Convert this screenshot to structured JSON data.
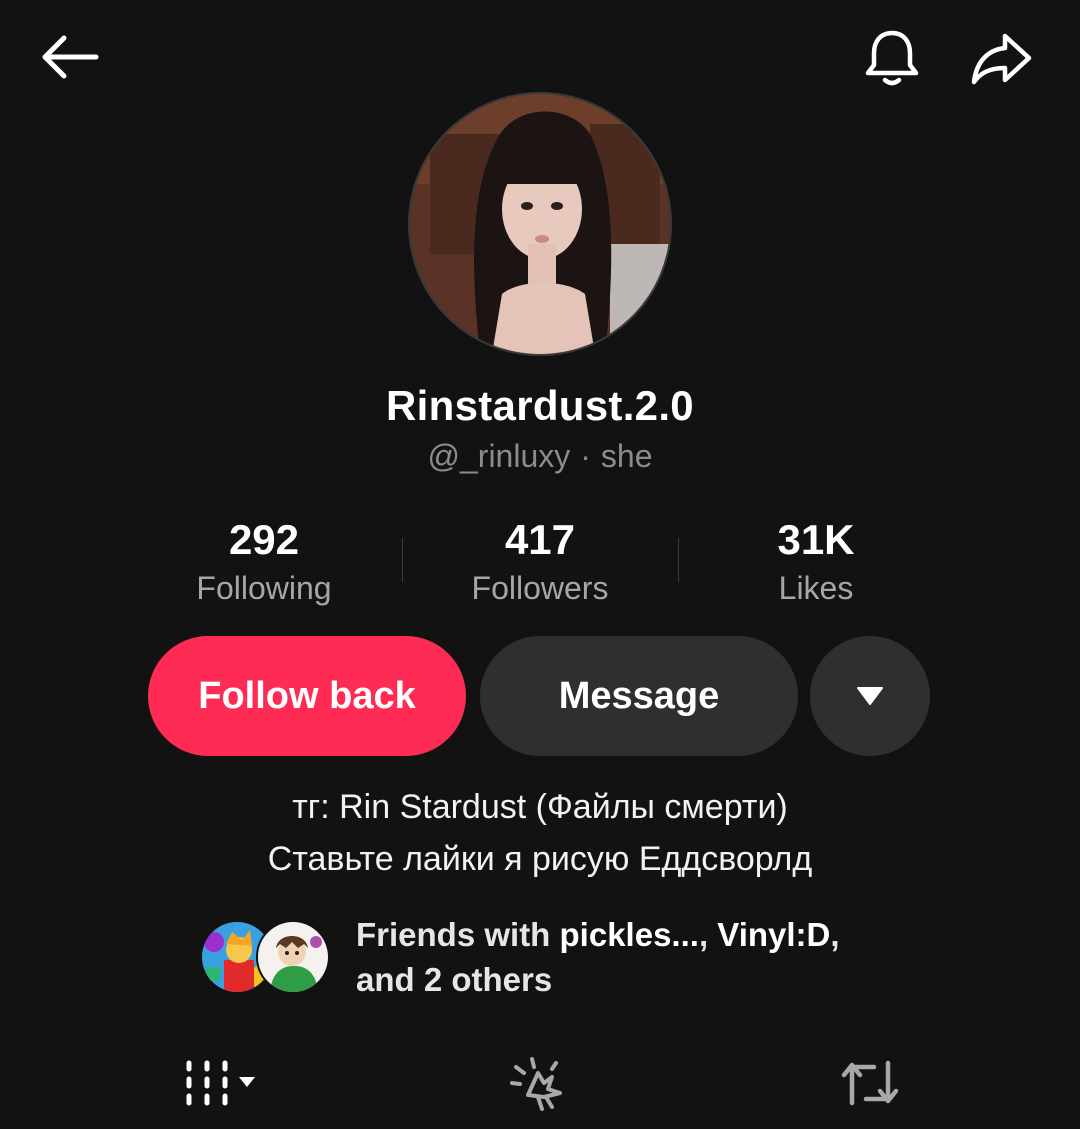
{
  "topbar": {
    "back_icon": "arrow-left-icon",
    "bell_icon": "bell-icon",
    "share_icon": "share-arrow-icon"
  },
  "profile": {
    "display_name": "Rinstardust.2.0",
    "username": "@_rinluxy",
    "separator": "·",
    "pronouns": "she"
  },
  "stats": [
    {
      "value": "292",
      "label": "Following"
    },
    {
      "value": "417",
      "label": "Followers"
    },
    {
      "value": "31K",
      "label": "Likes"
    }
  ],
  "actions": {
    "follow_label": "Follow back",
    "message_label": "Message",
    "more_icon": "caret-down-icon"
  },
  "bio": {
    "line1": "тг: Rin Stardust (Файлы смерти)",
    "line2": "Ставьте лайки я рисую Еддсворлд"
  },
  "friends": {
    "prefix": "Friends with ",
    "name1": "pickles...",
    "sep": ", ",
    "name2": "Vinyl:D",
    "suffix": ",",
    "line2": "and 2 others"
  },
  "tabs": {
    "videos_icon": "grid-columns-icon",
    "liked_icon": "sparkle-hand-icon",
    "reposts_icon": "repost-icon"
  },
  "colors": {
    "background": "#121212",
    "accent": "#fe2c55",
    "secondary_button": "#2f2f2f",
    "muted_text": "#a6a6a6"
  }
}
